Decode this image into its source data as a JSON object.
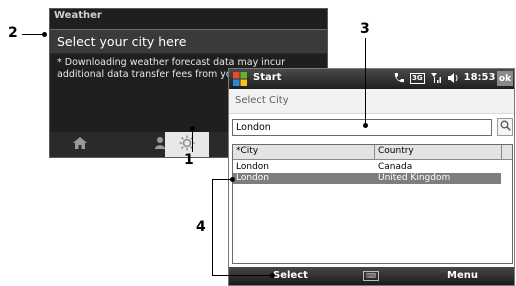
{
  "weather": {
    "title": "Weather",
    "city_prompt": "Select your city here",
    "note": "* Downloading weather forecast data may incur additional data transfer fees from your provider.",
    "tabs": [
      {
        "icon": "home-icon"
      },
      {
        "icon": "person-icon"
      },
      {
        "icon": "sun-gear-icon"
      }
    ]
  },
  "phone": {
    "status": {
      "start_label": "Start",
      "time": "18:53",
      "ok_label": "ok",
      "indicators": "3G"
    },
    "header": "Select City",
    "search_value": "London",
    "list": {
      "columns": [
        "*City",
        "Country"
      ],
      "rows": [
        {
          "city": "London",
          "country": "Canada"
        },
        {
          "city": "London",
          "country": "United Kingdom"
        }
      ],
      "selected_index": 1
    },
    "softkeys": {
      "left": "Select",
      "right": "Menu"
    }
  },
  "callouts": [
    "1",
    "2",
    "3",
    "4"
  ]
}
